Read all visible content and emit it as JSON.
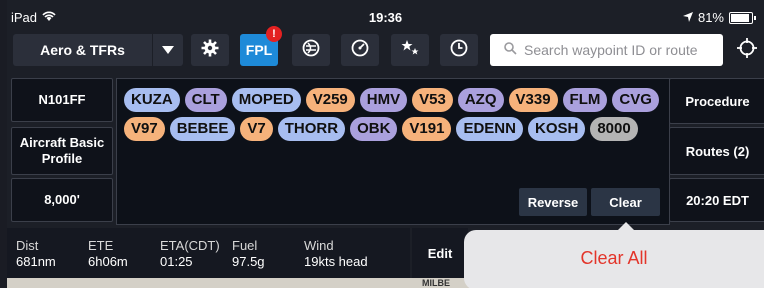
{
  "status_bar": {
    "device": "iPad",
    "time": "19:36",
    "battery": "81%"
  },
  "toolbar": {
    "layer_select": "Aero & TFRs",
    "fpl_label": "FPL",
    "fpl_badge": "!",
    "search_placeholder": "Search waypoint ID or route"
  },
  "flight": {
    "tail": "N101FF",
    "aircraft_profile": "Aircraft Basic Profile",
    "altitude": "8,000'"
  },
  "route": {
    "items": [
      {
        "label": "KUZA",
        "kind": "waypoint"
      },
      {
        "label": "CLT",
        "kind": "vor"
      },
      {
        "label": "MOPED",
        "kind": "waypoint"
      },
      {
        "label": "V259",
        "kind": "airway"
      },
      {
        "label": "HMV",
        "kind": "vor"
      },
      {
        "label": "V53",
        "kind": "airway"
      },
      {
        "label": "AZQ",
        "kind": "vor"
      },
      {
        "label": "V339",
        "kind": "airway"
      },
      {
        "label": "FLM",
        "kind": "vor"
      },
      {
        "label": "CVG",
        "kind": "vor"
      },
      {
        "label": "V97",
        "kind": "airway"
      },
      {
        "label": "BEBEE",
        "kind": "waypoint"
      },
      {
        "label": "V7",
        "kind": "airway"
      },
      {
        "label": "THORR",
        "kind": "waypoint"
      },
      {
        "label": "OBK",
        "kind": "vor"
      },
      {
        "label": "V191",
        "kind": "airway"
      },
      {
        "label": "EDENN",
        "kind": "waypoint"
      },
      {
        "label": "KOSH",
        "kind": "waypoint"
      },
      {
        "label": "8000",
        "kind": "alt"
      }
    ],
    "reverse_label": "Reverse",
    "clear_label": "Clear"
  },
  "right_panel": {
    "procedure": "Procedure",
    "routes": "Routes (2)",
    "time": "20:20 EDT"
  },
  "info": {
    "dist_label": "Dist",
    "dist": "681nm",
    "ete_label": "ETE",
    "ete": "6h06m",
    "eta_label": "ETA(CDT)",
    "eta": "01:25",
    "fuel_label": "Fuel",
    "fuel": "97.5g",
    "wind_label": "Wind",
    "wind": "19kts head"
  },
  "edit_label": "Edit",
  "map_text": "MILBE",
  "popover": {
    "clear_all": "Clear All"
  },
  "colors": {
    "accent": "#1e8ad8",
    "badge": "#e42121",
    "destructive": "#e3352a",
    "chip_waypoint": "#a7bdf0",
    "chip_vor": "#aaa0dd",
    "chip_airway": "#f6b27b",
    "chip_alt": "#b4b4b4"
  }
}
